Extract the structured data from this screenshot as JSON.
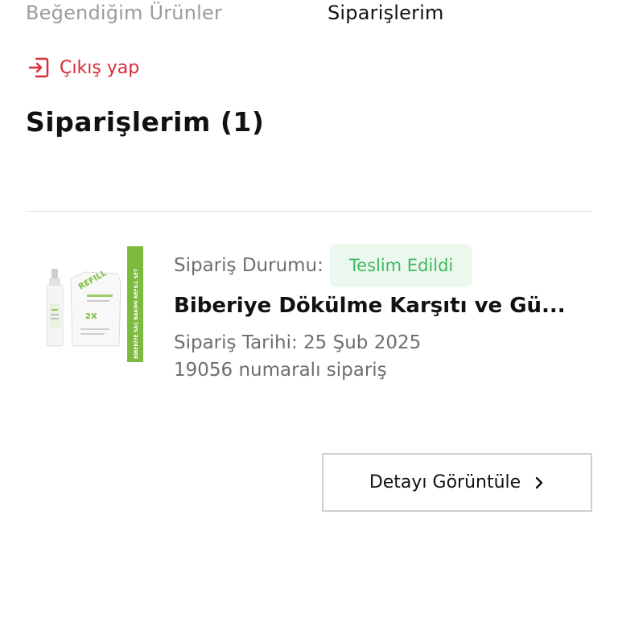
{
  "nav": {
    "liked_products": "Beğendiğim Ürünler",
    "orders": "Siparişlerim"
  },
  "logout": {
    "label": "Çıkış yap",
    "icon": "logout-icon"
  },
  "page": {
    "title": "Siparişlerim (1)"
  },
  "order": {
    "status_label": "Sipariş Durumu:",
    "status_value": "Teslim Edildi",
    "product_name": "Biberiye Dökülme Karşıtı ve Gü...",
    "date_text": "Sipariş Tarihi: 25 Şub 2025",
    "number_text": "19056 numaralı sipariş",
    "image_text": {
      "refill_label": "REFILL",
      "side_banner": "BİBERİYE SAÇ BAKIMI REFILL SET",
      "multiplier": "2X"
    }
  },
  "actions": {
    "detail_label": "Detayı Görüntüle",
    "detail_icon": "chevron-right-icon"
  },
  "colors": {
    "accent_red": "#d82b35",
    "status_green": "#3cb95e",
    "status_bg": "#ecf8ee",
    "product_green": "#7dbb3f"
  }
}
